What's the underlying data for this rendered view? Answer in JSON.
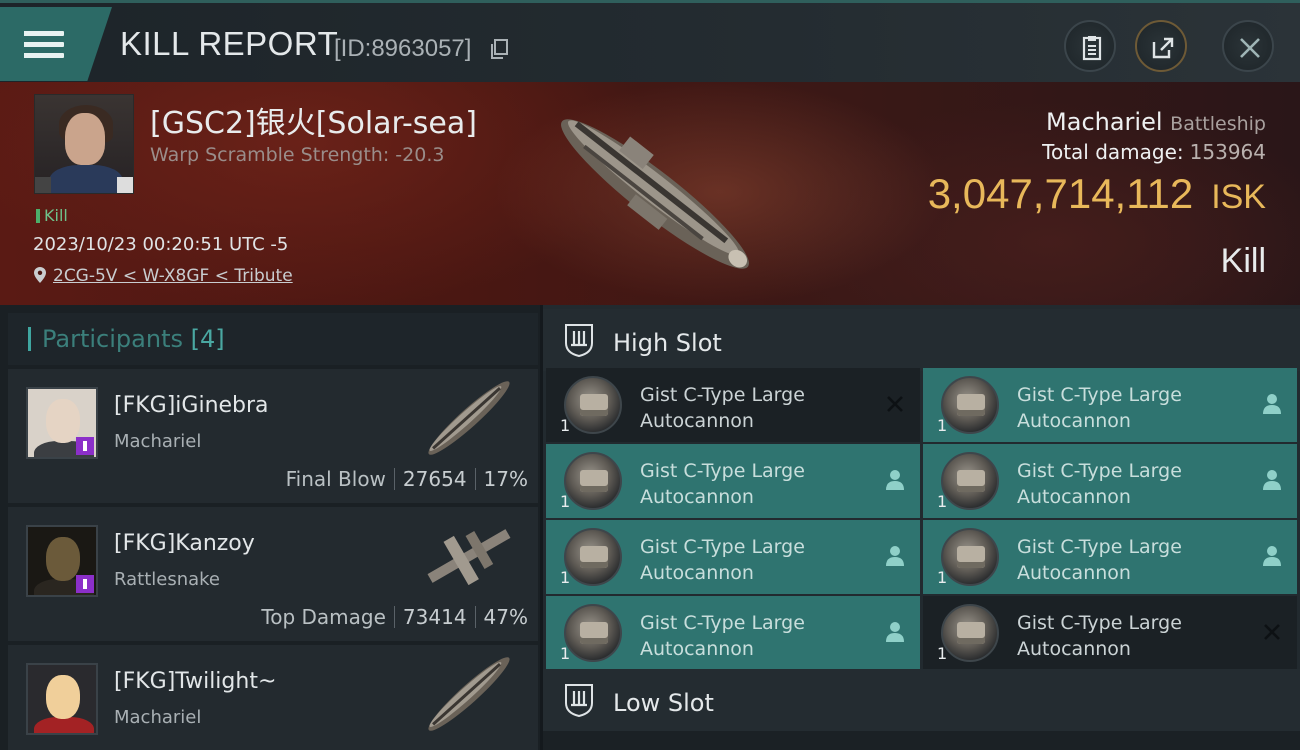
{
  "window": {
    "title": "KILL REPORT",
    "report_id": "[ID:8963057]"
  },
  "victim": {
    "name": "[GSC2]银火[Solar-sea]",
    "scramble": "Warp Scramble Strength: -20.3",
    "kill_tag": "Kill",
    "datetime": "2023/10/23 00:20:51 UTC -5",
    "location": "2CG-5V < W-X8GF < Tribute",
    "ship": "Machariel",
    "ship_class": "Battleship",
    "damage_label": "Total damage:",
    "damage_value": "153964",
    "isk_value": "3,047,714,112",
    "isk_unit": "ISK",
    "result": "Kill"
  },
  "participants": {
    "label": "Participants",
    "count": "[4]",
    "items": [
      {
        "name": "[FKG]iGinebra",
        "ship": "Machariel",
        "role": "Final Blow",
        "damage": "27654",
        "percent": "17%"
      },
      {
        "name": "[FKG]Kanzoy",
        "ship": "Rattlesnake",
        "role": "Top Damage",
        "damage": "73414",
        "percent": "47%"
      },
      {
        "name": "[FKG]Twilight~",
        "ship": "Machariel"
      }
    ]
  },
  "high_slot": {
    "label": "High Slot",
    "modules": [
      {
        "name": "Gist C-Type Large Autocannon",
        "qty": "1",
        "status": "destroyed"
      },
      {
        "name": "Gist C-Type Large Autocannon",
        "qty": "1",
        "status": "dropped"
      },
      {
        "name": "Gist C-Type Large Autocannon",
        "qty": "1",
        "status": "dropped"
      },
      {
        "name": "Gist C-Type Large Autocannon",
        "qty": "1",
        "status": "dropped"
      },
      {
        "name": "Gist C-Type Large Autocannon",
        "qty": "1",
        "status": "dropped"
      },
      {
        "name": "Gist C-Type Large Autocannon",
        "qty": "1",
        "status": "dropped"
      },
      {
        "name": "Gist C-Type Large Autocannon",
        "qty": "1",
        "status": "dropped"
      },
      {
        "name": "Gist C-Type Large Autocannon",
        "qty": "1",
        "status": "destroyed"
      }
    ]
  },
  "low_slot": {
    "label": "Low Slot"
  },
  "colors": {
    "accent": "#2c6a66",
    "isk": "#e8b85a",
    "dropped_bg": "#2f7470",
    "destroyed_bg": "#1b2125"
  },
  "icons": {
    "menu": "hamburger-icon",
    "copy": "copy-icon",
    "clipboard": "clipboard-icon",
    "share": "share-icon",
    "close": "close-icon",
    "location": "map-pin-icon",
    "high_slot": "high-slot-icon",
    "low_slot": "low-slot-icon",
    "dropped": "person-icon",
    "destroyed": "cross-icon"
  }
}
